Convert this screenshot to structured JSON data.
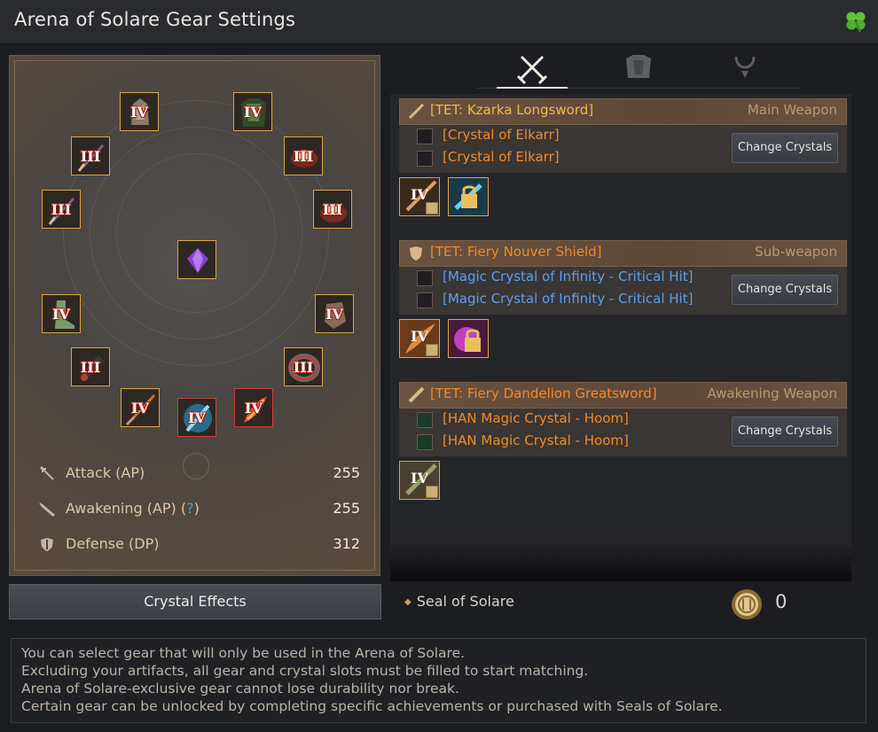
{
  "window": {
    "title": "Arena of Solare Gear Settings",
    "corner_icon": "clover-icon"
  },
  "left_panel": {
    "equip_slots": [
      {
        "slot": "helmet",
        "tier": "IV"
      },
      {
        "slot": "armor",
        "tier": "IV"
      },
      {
        "slot": "ring-1",
        "tier": "III"
      },
      {
        "slot": "necklace",
        "tier": "III"
      },
      {
        "slot": "ring-2",
        "tier": "III"
      },
      {
        "slot": "earring",
        "tier": "III"
      },
      {
        "slot": "center-crystal",
        "tier": ""
      },
      {
        "slot": "shoes",
        "tier": "IV"
      },
      {
        "slot": "gloves",
        "tier": "IV"
      },
      {
        "slot": "belt-left",
        "tier": "III"
      },
      {
        "slot": "belt",
        "tier": "III"
      },
      {
        "slot": "main-weapon",
        "tier": "IV"
      },
      {
        "slot": "sub-weapon",
        "tier": "IV"
      },
      {
        "slot": "awakening-weapon",
        "tier": "IV"
      }
    ],
    "stats": [
      {
        "label": "Attack (AP)",
        "value": "255",
        "icon": "sword-icon"
      },
      {
        "label": "Awakening (AP)",
        "help": "?",
        "value": "255",
        "icon": "greatsword-icon"
      },
      {
        "label": "Defense (DP)",
        "value": "312",
        "icon": "shield-icon"
      }
    ],
    "crystal_effects_button": "Crystal Effects"
  },
  "tabs": [
    {
      "name": "weapons",
      "icon": "crossed-swords-icon",
      "active": true
    },
    {
      "name": "armor",
      "icon": "armor-icon",
      "active": false
    },
    {
      "name": "accessories",
      "icon": "necklace-icon",
      "active": false
    }
  ],
  "gear": [
    {
      "name": "[TET: Kzarka Longsword]",
      "type": "Main Weapon",
      "crystals": [
        "[Crystal of Elkarr]",
        "[Crystal of Elkarr]"
      ],
      "crystal_color": "orange",
      "change_button": "Change Crystals",
      "item_tier": "IV"
    },
    {
      "name": "[TET: Fiery Nouver Shield]",
      "type": "Sub-weapon",
      "crystals": [
        "[Magic Crystal of Infinity - Critical Hit]",
        "[Magic Crystal of Infinity - Critical Hit]"
      ],
      "crystal_color": "blue",
      "change_button": "Change Crystals",
      "item_tier": "IV"
    },
    {
      "name": "[TET: Fiery Dandelion Greatsword]",
      "type": "Awakening Weapon",
      "crystals": [
        "[HAN Magic Crystal - Hoom]",
        "[HAN Magic Crystal - Hoom]"
      ],
      "crystal_color": "orange",
      "change_button": "Change Crystals",
      "item_tier": "IV"
    }
  ],
  "seal": {
    "label": "Seal of Solare",
    "count": "0"
  },
  "info_lines": [
    "You can select gear that will only be used in the Arena of Solare.",
    "Excluding your artifacts, all gear and crystal slots must be filled to start matching.",
    "Arena of Solare-exclusive gear cannot lose durability nor break.",
    "Certain gear can be unlocked by completing specific achievements or purchased with Seals of Solare."
  ],
  "colors": {
    "gold_name": "#f2b84a",
    "orange_name": "#f08a2a",
    "blue_crystal": "#5a9ef0",
    "slot_border": "#d9a63a"
  }
}
